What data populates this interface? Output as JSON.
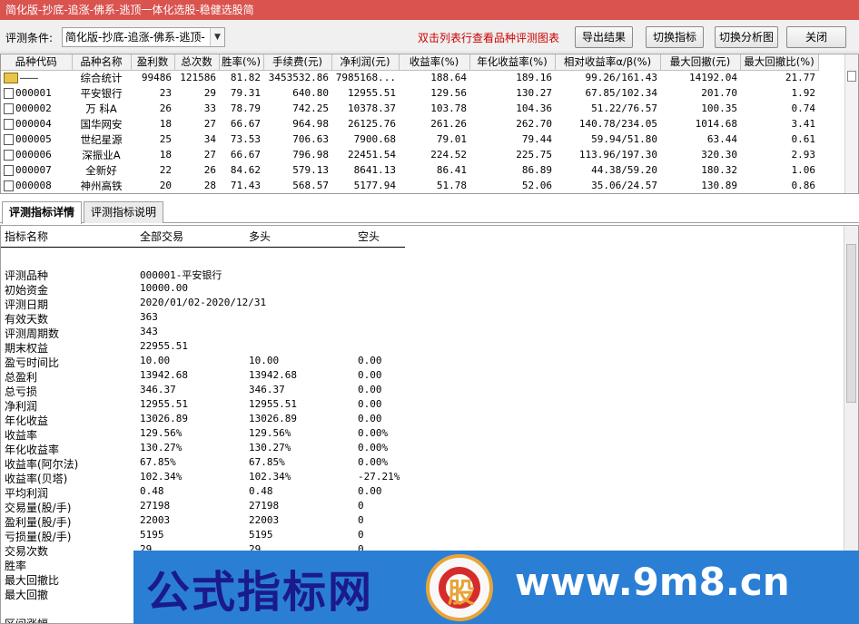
{
  "window": {
    "title": "简化版-抄底-追涨-佛系-逃顶一体化选股-稳健选股简"
  },
  "toolbar": {
    "condition_label": "评测条件:",
    "condition_value": "简化版-抄底-追涨-佛系-逃顶-",
    "hint": "双击列表行查看品种评测图表",
    "buttons": [
      "导出结果",
      "切换指标",
      "切换分析图",
      "关闭"
    ]
  },
  "grid": {
    "columns": [
      "品种代码",
      "品种名称",
      "盈利数",
      "总次数",
      "胜率(%)",
      "手续费(元)",
      "净利润(元)",
      "收益率(%)",
      "年化收益率(%)",
      "相对收益率α/β(%)",
      "最大回撤(元)",
      "最大回撤比(%)"
    ],
    "rows": [
      [
        "———",
        "综合统计",
        "99486",
        "121586",
        "81.82",
        "3453532.86",
        "7985168...",
        "188.64",
        "189.16",
        "99.26/161.43",
        "14192.04",
        "21.77"
      ],
      [
        "000001",
        "平安银行",
        "23",
        "29",
        "79.31",
        "640.80",
        "12955.51",
        "129.56",
        "130.27",
        "67.85/102.34",
        "201.70",
        "1.92"
      ],
      [
        "000002",
        "万 科A",
        "26",
        "33",
        "78.79",
        "742.25",
        "10378.37",
        "103.78",
        "104.36",
        "51.22/76.57",
        "100.35",
        "0.74"
      ],
      [
        "000004",
        "国华网安",
        "18",
        "27",
        "66.67",
        "964.98",
        "26125.76",
        "261.26",
        "262.70",
        "140.78/234.05",
        "1014.68",
        "3.41"
      ],
      [
        "000005",
        "世纪星源",
        "25",
        "34",
        "73.53",
        "706.63",
        "7900.68",
        "79.01",
        "79.44",
        "59.94/51.80",
        "63.44",
        "0.61"
      ],
      [
        "000006",
        "深振业A",
        "18",
        "27",
        "66.67",
        "796.98",
        "22451.54",
        "224.52",
        "225.75",
        "113.96/197.30",
        "320.30",
        "2.93"
      ],
      [
        "000007",
        "全新好",
        "22",
        "26",
        "84.62",
        "579.13",
        "8641.13",
        "86.41",
        "86.89",
        "44.38/59.20",
        "180.32",
        "1.06"
      ],
      [
        "000008",
        "神州高铁",
        "20",
        "28",
        "71.43",
        "568.57",
        "5177.94",
        "51.78",
        "52.06",
        "35.06/24.57",
        "130.89",
        "0.86"
      ]
    ]
  },
  "tabs": [
    "评测指标详情",
    "评测指标说明"
  ],
  "detail": {
    "headers": [
      "指标名称",
      "全部交易",
      "多头",
      "空头"
    ],
    "rows": [
      [
        "",
        "",
        "",
        ""
      ],
      [
        "评测品种",
        "000001-平安银行",
        "",
        ""
      ],
      [
        "初始资金",
        "10000.00",
        "",
        ""
      ],
      [
        "评测日期",
        "2020/01/02-2020/12/31",
        "",
        ""
      ],
      [
        "有效天数",
        "363",
        "",
        ""
      ],
      [
        "评测周期数",
        "343",
        "",
        ""
      ],
      [
        "期末权益",
        "22955.51",
        "",
        ""
      ],
      [
        "盈亏时间比",
        "10.00",
        "10.00",
        "0.00"
      ],
      [
        "总盈利",
        "13942.68",
        "13942.68",
        "0.00"
      ],
      [
        "总亏损",
        "346.37",
        "346.37",
        "0.00"
      ],
      [
        "净利润",
        "12955.51",
        "12955.51",
        "0.00"
      ],
      [
        "年化收益",
        "13026.89",
        "13026.89",
        "0.00"
      ],
      [
        "收益率",
        "129.56%",
        "129.56%",
        "0.00%"
      ],
      [
        "年化收益率",
        "130.27%",
        "130.27%",
        "0.00%"
      ],
      [
        "收益率(阿尔法)",
        "67.85%",
        "67.85%",
        "0.00%"
      ],
      [
        "收益率(贝塔)",
        "102.34%",
        "102.34%",
        "-27.21%"
      ],
      [
        "平均利润",
        "0.48",
        "0.48",
        "0.00"
      ],
      [
        "交易量(股/手)",
        "27198",
        "27198",
        "0"
      ],
      [
        "盈利量(股/手)",
        "22003",
        "22003",
        "0"
      ],
      [
        "亏损量(股/手)",
        "5195",
        "5195",
        "0"
      ],
      [
        "交易次数",
        "29",
        "29",
        "0"
      ],
      [
        "胜率",
        "",
        "",
        ""
      ],
      [
        "最大回撤比",
        "",
        "",
        ""
      ],
      [
        "最大回撤",
        "",
        "",
        ""
      ],
      [
        "",
        "",
        "",
        ""
      ],
      [
        "区间涨幅",
        "",
        "",
        ""
      ]
    ]
  },
  "banner": {
    "brand": "公式指标网",
    "logo_glyph": "股",
    "url": "www.9m8.cn"
  }
}
